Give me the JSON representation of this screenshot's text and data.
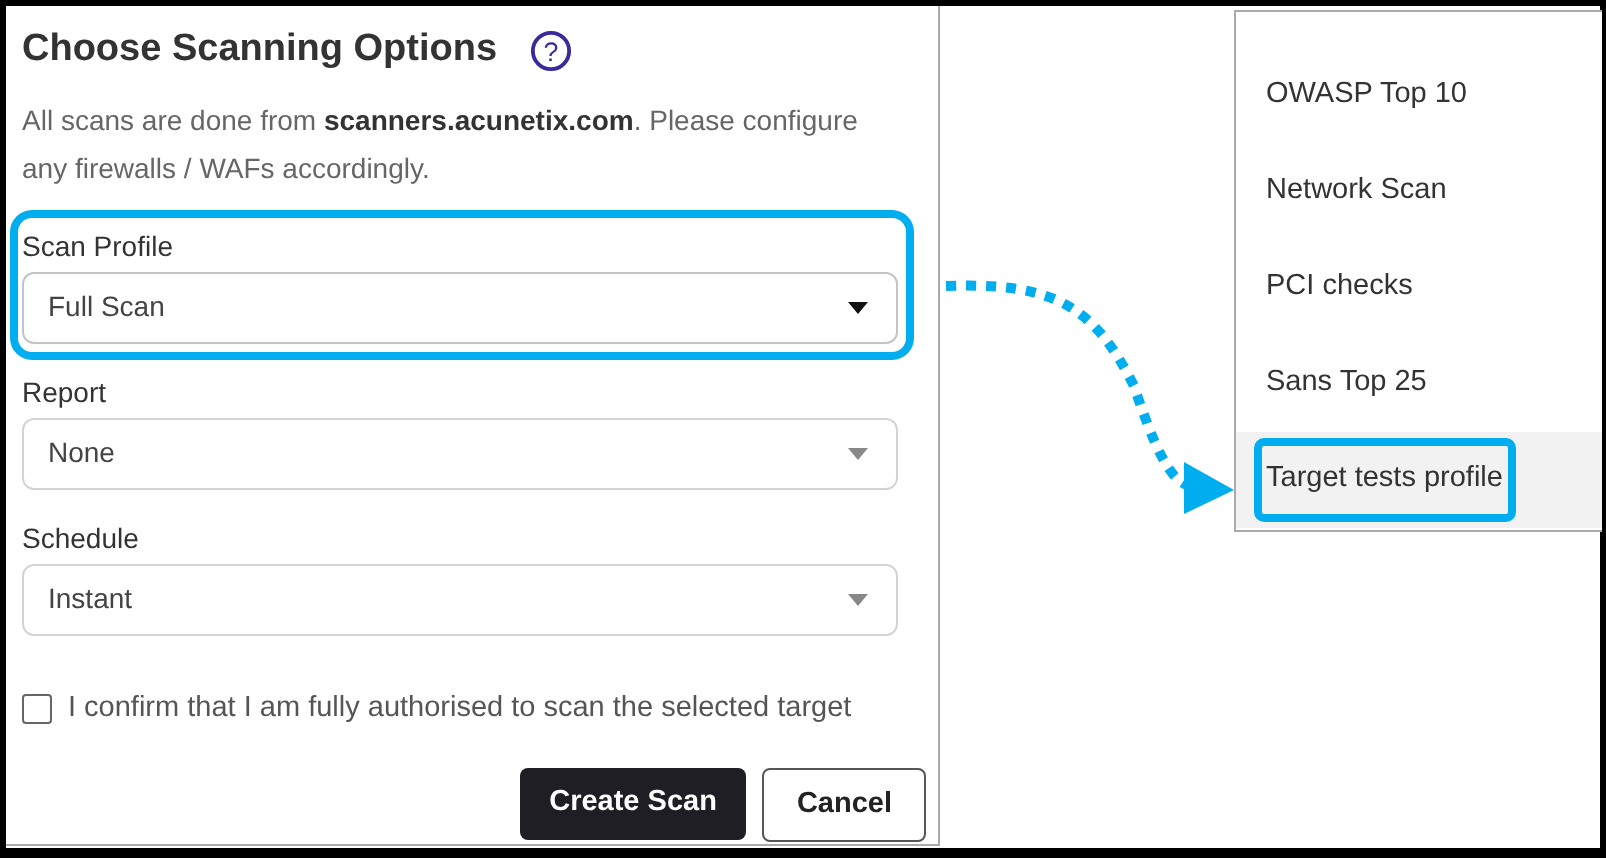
{
  "panel": {
    "title": "Choose Scanning Options",
    "help_icon": "?",
    "description": "All scans are done from **scanners.acunetix.com**. Please configure any firewalls / WAFs accordingly.",
    "fields": [
      {
        "label": "Scan Profile",
        "value": "Full Scan",
        "focused": true,
        "highlighted": true
      },
      {
        "label": "Report",
        "value": "None",
        "focused": false,
        "highlighted": false
      },
      {
        "label": "Schedule",
        "value": "Instant",
        "focused": false,
        "highlighted": false
      }
    ],
    "confirm": {
      "label": "I confirm that I am fully authorised to scan the selected target",
      "checked": false
    },
    "buttons": [
      {
        "label": "Create Scan",
        "kind": "primary"
      },
      {
        "label": "Cancel",
        "kind": "secondary"
      }
    ]
  },
  "dropdown": {
    "items": [
      {
        "label": "OWASP Top 10",
        "selected": false,
        "highlighted": false
      },
      {
        "label": "Network Scan",
        "selected": false,
        "highlighted": false
      },
      {
        "label": "PCI checks",
        "selected": false,
        "highlighted": false
      },
      {
        "label": "Sans Top 25",
        "selected": false,
        "highlighted": false
      },
      {
        "label": "Target tests profile",
        "selected": true,
        "highlighted": true
      }
    ]
  }
}
